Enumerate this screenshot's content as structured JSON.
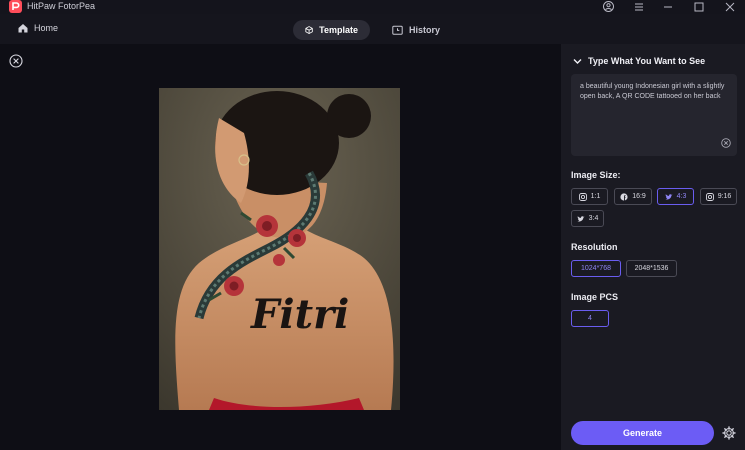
{
  "app": {
    "title": "HitPaw FotorPea"
  },
  "nav": {
    "home_label": "Home",
    "tabs": [
      {
        "label": "Template",
        "active": true
      },
      {
        "label": "History",
        "active": false
      }
    ]
  },
  "preview": {
    "tattoo_text": "Fitri"
  },
  "panel": {
    "prompt_heading": "Type What You Want to See",
    "prompt_text": "a beautiful young Indonesian girl with a slightly open back, A QR CODE tattooed on her back",
    "image_size_label": "Image Size:",
    "sizes": [
      {
        "label": "1:1",
        "icon": "instagram-icon",
        "active": false
      },
      {
        "label": "16:9",
        "icon": "facebook-icon",
        "active": false
      },
      {
        "label": "4:3",
        "icon": "twitter-icon",
        "active": true
      },
      {
        "label": "9:16",
        "icon": "instagram-icon",
        "active": false
      },
      {
        "label": "3:4",
        "icon": "twitter-icon",
        "active": false
      }
    ],
    "resolution_label": "Resolution",
    "resolutions": [
      {
        "label": "1024*768",
        "active": true
      },
      {
        "label": "2048*1536",
        "active": false
      }
    ],
    "pcs_label": "Image PCS",
    "pcs_value": "4",
    "generate_label": "Generate"
  },
  "colors": {
    "accent": "#6c5cf5",
    "background": "#0f0f17",
    "panel": "#1a1a22"
  }
}
